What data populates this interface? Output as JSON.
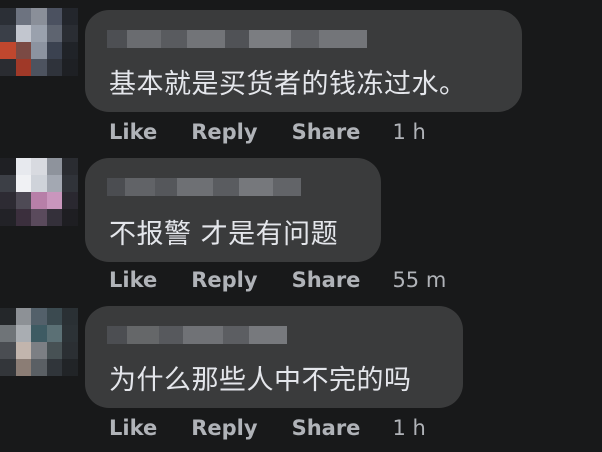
{
  "comments": [
    {
      "text": "基本就是买货者的钱冻过水。",
      "actions": {
        "like": "Like",
        "reply": "Reply",
        "share": "Share"
      },
      "time": "1 h",
      "avatar_colors": [
        "#2b2f36",
        "#6d7380",
        "#8a8f99",
        "#4b5160",
        "#23262c",
        "#3a3f48",
        "#c2c6cf",
        "#9aa1ad",
        "#5e6470",
        "#2a2d33",
        "#c0472e",
        "#7b4a44",
        "#8c93a0",
        "#3b4250",
        "#202328",
        "#2a2c31",
        "#a03928",
        "#4d535f",
        "#2f333b",
        "#1e2024"
      ]
    },
    {
      "text": "不报警 才是有问题",
      "actions": {
        "like": "Like",
        "reply": "Reply",
        "share": "Share"
      },
      "time": "55 m",
      "avatar_colors": [
        "#1f2024",
        "#e7e9ee",
        "#d8dae0",
        "#8e939c",
        "#2a2c31",
        "#3c3f46",
        "#f0f1f4",
        "#cfd3da",
        "#a3a8b2",
        "#303339",
        "#2d2b33",
        "#4e4a55",
        "#b77fa8",
        "#c996bd",
        "#2a2830",
        "#222227",
        "#3b2f3d",
        "#5a4a5c",
        "#34303a",
        "#1e1e22"
      ]
    },
    {
      "text": "为什么那些人中不完的吗",
      "actions": {
        "like": "Like",
        "reply": "Reply",
        "share": "Share"
      },
      "time": "1 h",
      "avatar_colors": [
        "#24272a",
        "#8d9196",
        "#53606a",
        "#3b4a50",
        "#2a3034",
        "#6f7478",
        "#a9adb2",
        "#3e5b63",
        "#5b7075",
        "#2c3236",
        "#4a4d52",
        "#c2b5ad",
        "#7c7f84",
        "#475154",
        "#2b2f33",
        "#33363a",
        "#8b7d75",
        "#5a5f64",
        "#30353a",
        "#212427"
      ]
    }
  ]
}
